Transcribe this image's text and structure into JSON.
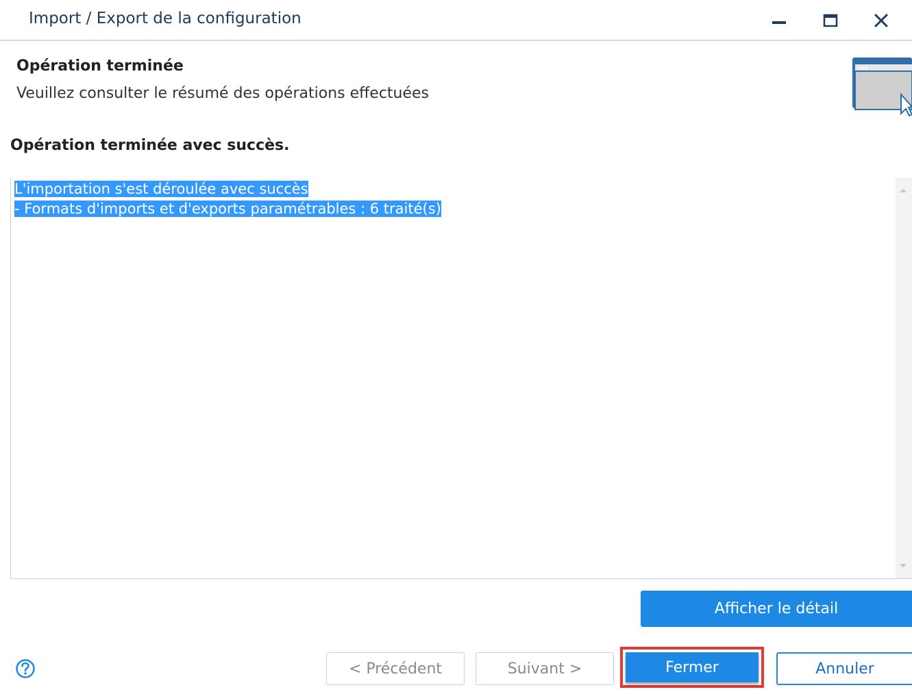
{
  "window": {
    "title": "Import / Export de la configuration",
    "controls": {
      "minimize_icon": "minimize-icon",
      "maximize_icon": "maximize-icon",
      "close_icon": "close-icon"
    }
  },
  "header": {
    "title": "Opération terminée",
    "subtitle": "Veuillez consulter le résumé des opérations effectuées",
    "icon": "window-cursor-icon"
  },
  "status": "Opération terminée avec succès.",
  "summary": {
    "lines": [
      "L'importation s'est déroulée avec succès",
      "- Formats d'imports et d'exports paramétrables : 6 traité(s)"
    ],
    "selected": true
  },
  "buttons": {
    "detail": "Afficher le détail",
    "previous": "< Précédent",
    "next": "Suivant >",
    "close": "Fermer",
    "cancel": "Annuler"
  },
  "help_icon": "help-icon",
  "colors": {
    "accent": "#1e88e5",
    "selection": "#3399ff",
    "highlight_border": "#e53935",
    "title_text": "#1f3a5a"
  }
}
